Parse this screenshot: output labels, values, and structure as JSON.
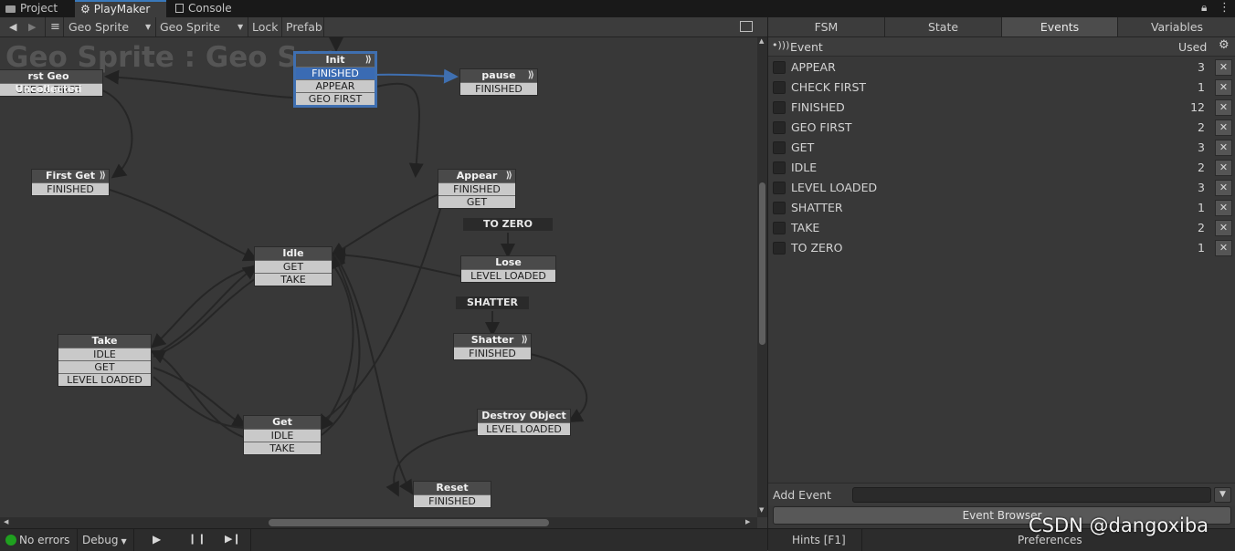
{
  "tabs": [
    {
      "label": "Project",
      "icon": "folder-icon"
    },
    {
      "label": "PlayMaker",
      "icon": "playmaker-icon"
    },
    {
      "label": "Console",
      "icon": "console-icon"
    }
  ],
  "toolbar": {
    "fsm_object": "Geo Sprite",
    "fsm_name": "Geo Sprite",
    "lock": "Lock",
    "prefab": "Prefab"
  },
  "canvas": {
    "title": "Geo Sprite : Geo Spr",
    "states": {
      "init": {
        "name": "Init",
        "events": [
          "FINISHED",
          "APPEAR",
          "GEO FIRST"
        ]
      },
      "first_geo": {
        "name": "rst Geo Uncollected",
        "events": [
          "CHECK FIRST"
        ]
      },
      "pause": {
        "name": "pause",
        "events": [
          "FINISHED"
        ]
      },
      "first_get": {
        "name": "First Get",
        "events": [
          "FINISHED"
        ]
      },
      "appear": {
        "name": "Appear",
        "events": [
          "FINISHED",
          "GET"
        ]
      },
      "idle": {
        "name": "Idle",
        "events": [
          "GET",
          "TAKE"
        ]
      },
      "lose": {
        "name": "Lose",
        "events": [
          "LEVEL LOADED"
        ]
      },
      "take": {
        "name": "Take",
        "events": [
          "IDLE",
          "GET",
          "LEVEL LOADED"
        ]
      },
      "shatter": {
        "name": "Shatter",
        "events": [
          "FINISHED"
        ]
      },
      "destroy": {
        "name": "Destroy Object",
        "events": [
          "LEVEL LOADED"
        ]
      },
      "get": {
        "name": "Get",
        "events": [
          "IDLE",
          "TAKE"
        ]
      },
      "reset": {
        "name": "Reset",
        "events": [
          "FINISHED"
        ]
      }
    },
    "global_transitions": {
      "to_zero": "TO ZERO",
      "shatter": "SHATTER"
    }
  },
  "status": {
    "errors": "No errors",
    "mode": "Debug",
    "hints": "Hints [F1]",
    "preferences": "Preferences"
  },
  "panel": {
    "tabs": [
      "FSM",
      "State",
      "Events",
      "Variables"
    ],
    "active_tab": "Events",
    "header": {
      "event": "Event",
      "used": "Used"
    },
    "events": [
      {
        "name": "APPEAR",
        "used": "3"
      },
      {
        "name": "CHECK FIRST",
        "used": "1"
      },
      {
        "name": "FINISHED",
        "used": "12"
      },
      {
        "name": "GEO FIRST",
        "used": "2"
      },
      {
        "name": "GET",
        "used": "3"
      },
      {
        "name": "IDLE",
        "used": "2"
      },
      {
        "name": "LEVEL LOADED",
        "used": "3"
      },
      {
        "name": "SHATTER",
        "used": "1"
      },
      {
        "name": "TAKE",
        "used": "2"
      },
      {
        "name": "TO ZERO",
        "used": "1"
      }
    ],
    "add_event": "Add Event",
    "event_browser": "Event Browser"
  },
  "watermark": "CSDN @dangoxiba",
  "colors": {
    "accent": "#3a79bb",
    "selected_event": "#3a6bb3",
    "ok": "#1fa01f"
  }
}
